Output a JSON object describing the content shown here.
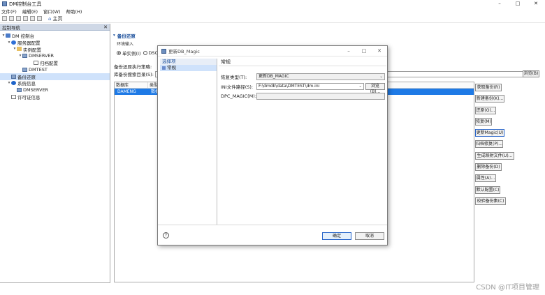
{
  "window": {
    "title": "DM控制台工具",
    "min": "–",
    "max": "□",
    "close": "✕"
  },
  "menu": [
    "文件(F)",
    "编辑(E)",
    "窗口(W)",
    "帮助(H)"
  ],
  "toolbar": {
    "home_label": "主页"
  },
  "left_pane": {
    "tab_label": "控制导航",
    "tab_close": "✕",
    "tree": [
      {
        "label": "DM 控制台",
        "twisty": "▾",
        "icon": "console"
      },
      {
        "label": "服务器配置",
        "twisty": "▾",
        "icon": "gear"
      },
      {
        "label": "实例配置",
        "twisty": "▾",
        "icon": "folder"
      },
      {
        "label": "DMSERVER",
        "twisty": "▾",
        "icon": "database"
      },
      {
        "label": "归档配置",
        "twisty": "",
        "icon": "document"
      },
      {
        "label": "DMTEST",
        "twisty": "",
        "icon": "database"
      },
      {
        "label": "备份还原",
        "twisty": "",
        "icon": "backup"
      },
      {
        "label": "系统信息",
        "twisty": "▾",
        "icon": "info"
      },
      {
        "label": "DMSERVER",
        "twisty": "",
        "icon": "database"
      },
      {
        "label": "许可证信息",
        "twisty": "",
        "icon": "document"
      }
    ]
  },
  "main": {
    "section_title": "备份还原",
    "group_label": "环境输入",
    "radio_single": "单实例(I)",
    "radio_dsc": "DSC",
    "exec_label": "备份还原执行策略:",
    "search_dir_label": "库备份搜索目录(S):",
    "search_dir_value": "F:\\",
    "browse_right": "浏览(B)",
    "grid_headers": [
      "数据库",
      "类型"
    ],
    "grid_row": [
      "DAMENG",
      "数据"
    ],
    "actions": [
      "获取备份(R)",
      "新建备份(K)...",
      "还原(O)...",
      "恢复(M)",
      "更新Magic(U)",
      "归档修复(P)...",
      "生成映射文件(U)...",
      "删除备份(D)",
      "属性(A)...",
      "默认配置(C)",
      "校验备份集(C)"
    ]
  },
  "dialog": {
    "title": "更新DB_Magic",
    "nav_header": "选择项",
    "nav_item": "常规",
    "panel_title": "常规",
    "update_type_label": "恢复类型(T):",
    "update_type_value": "更新DB_MAGIC",
    "ini_label": "INI文件路径(S):",
    "ini_value": "F:\\dmdb\\data\\DMTEST\\dm.ini",
    "browse_btn": "浏览(B)...",
    "magic_label": "DPC_MAGIC(M):",
    "magic_value": "",
    "ok": "确定",
    "cancel": "取消",
    "help_glyph": "?"
  },
  "watermark": "CSDN @IT项目管理"
}
